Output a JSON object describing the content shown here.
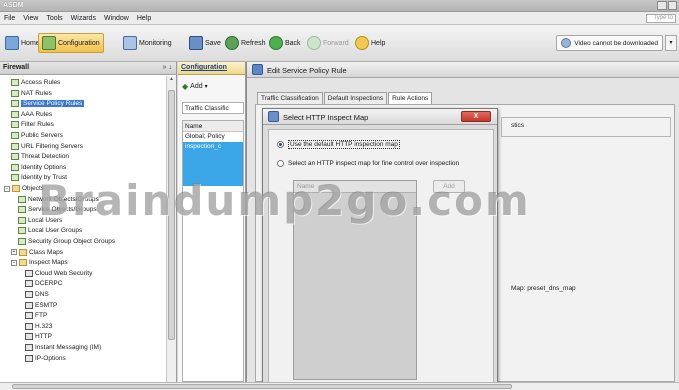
{
  "app": {
    "title": "ASDM"
  },
  "menu": [
    "File",
    "View",
    "Tools",
    "Wizards",
    "Window",
    "Help"
  ],
  "search_placeholder": "Type to",
  "toolbar": {
    "home": "Home",
    "configuration": "Configuration",
    "monitoring": "Monitoring",
    "save": "Save",
    "refresh": "Refresh",
    "back": "Back",
    "forward": "Forward",
    "help": "Help",
    "video": "Video cannot be downloaded"
  },
  "firewall_pane": {
    "title": "Firewall",
    "pin": "» ↓",
    "items": [
      {
        "label": "Access Rules",
        "indent": 1,
        "icon": "rule"
      },
      {
        "label": "NAT Rules",
        "indent": 1,
        "icon": "rule"
      },
      {
        "label": "Service Policy Rules",
        "indent": 1,
        "icon": "rule",
        "selected": true
      },
      {
        "label": "AAA Rules",
        "indent": 1,
        "icon": "rule"
      },
      {
        "label": "Filter Rules",
        "indent": 1,
        "icon": "rule"
      },
      {
        "label": "Public Servers",
        "indent": 1,
        "icon": "rule"
      },
      {
        "label": "URL Filtering Servers",
        "indent": 1,
        "icon": "rule"
      },
      {
        "label": "Threat Detection",
        "indent": 1,
        "icon": "rule"
      },
      {
        "label": "Identity Options",
        "indent": 1,
        "icon": "rule"
      },
      {
        "label": "Identity by Trust",
        "indent": 1,
        "icon": "rule"
      },
      {
        "label": "Objects",
        "indent": 0,
        "icon": "folder",
        "expander": "−"
      },
      {
        "label": "Network Objects/Groups",
        "indent": 2,
        "icon": "rule"
      },
      {
        "label": "Service Objects/Groups",
        "indent": 2,
        "icon": "rule"
      },
      {
        "label": "Local Users",
        "indent": 2,
        "icon": "rule"
      },
      {
        "label": "Local User Groups",
        "indent": 2,
        "icon": "rule"
      },
      {
        "label": "Security Group Object Groups",
        "indent": 2,
        "icon": "rule"
      },
      {
        "label": "Class Maps",
        "indent": 1,
        "icon": "folder",
        "expander": "+"
      },
      {
        "label": "Inspect Maps",
        "indent": 1,
        "icon": "folder",
        "expander": "−"
      },
      {
        "label": "Cloud Web Security",
        "indent": 3,
        "icon": "map"
      },
      {
        "label": "DCERPC",
        "indent": 3,
        "icon": "map"
      },
      {
        "label": "DNS",
        "indent": 3,
        "icon": "map"
      },
      {
        "label": "ESMTP",
        "indent": 3,
        "icon": "map"
      },
      {
        "label": "FTP",
        "indent": 3,
        "icon": "map"
      },
      {
        "label": "H.323",
        "indent": 3,
        "icon": "map"
      },
      {
        "label": "HTTP",
        "indent": 3,
        "icon": "map"
      },
      {
        "label": "Instant Messaging (IM)",
        "indent": 3,
        "icon": "map"
      },
      {
        "label": "IP-Options",
        "indent": 3,
        "icon": "map"
      }
    ]
  },
  "config_pane": {
    "title": "Configuration",
    "add": "Add",
    "traffic_tab": "Traffic Classific",
    "col_name": "Name",
    "row_global": "Global; Policy",
    "row_inspection": "inspection_c"
  },
  "edit_dialog": {
    "title": "Edit Service Policy Rule",
    "tabs": [
      "Traffic Classification",
      "Default Inspections",
      "Rule Actions"
    ],
    "active_tab": "Rule Actions",
    "stats_text": "stics",
    "map_text": "Map: preset_dns_map"
  },
  "select_dialog": {
    "title": "Select HTTP Inspect Map",
    "close": "X",
    "option_default": "Use the default HTTP inspection map",
    "option_select": "Select an HTTP inspect map for fine control over inspection",
    "col_name": "Name",
    "add": "Add"
  },
  "watermark": "Braindump2go.com"
}
